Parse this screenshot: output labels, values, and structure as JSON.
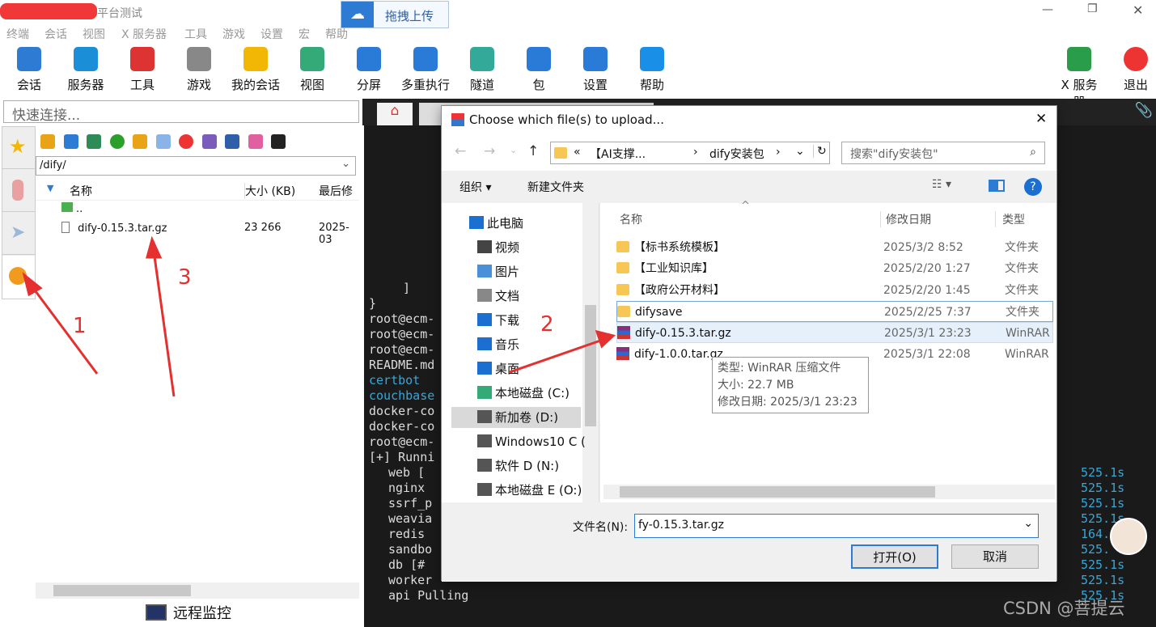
{
  "window": {
    "title": "平台测试",
    "upload_label": "拖拽上传"
  },
  "menu": [
    "终端",
    "会话",
    "视图",
    "X 服务器",
    "工具",
    "游戏",
    "设置",
    "宏",
    "帮助"
  ],
  "toolbar": [
    {
      "label": "会话",
      "icon": "session-icon",
      "color": "#2e7bd4"
    },
    {
      "label": "服务器",
      "icon": "servers-icon",
      "color": "#1a8fd8"
    },
    {
      "label": "工具",
      "icon": "tools-icon",
      "color": "#d33"
    },
    {
      "label": "游戏",
      "icon": "gamepad-icon",
      "color": "#888"
    },
    {
      "label": "我的会话",
      "icon": "star-icon",
      "color": "#f2b705"
    },
    {
      "label": "视图",
      "icon": "view-icon",
      "color": "#3a7"
    },
    {
      "label": "分屏",
      "icon": "split-icon",
      "color": "#2a7bd8"
    },
    {
      "label": "多重执行",
      "icon": "fork-icon",
      "color": "#2a7bd8"
    },
    {
      "label": "隧道",
      "icon": "tunnel-icon",
      "color": "#3a9"
    },
    {
      "label": "包",
      "icon": "package-icon",
      "color": "#2a7bd8"
    },
    {
      "label": "设置",
      "icon": "gear-icon",
      "color": "#2a7bd8"
    },
    {
      "label": "帮助",
      "icon": "help-icon",
      "color": "#1a8fe8"
    }
  ],
  "toolbar_right": [
    {
      "label": "X 服务器",
      "icon": "x-server-icon"
    },
    {
      "label": "退出",
      "icon": "power-icon"
    }
  ],
  "quick_connect": {
    "placeholder": "快速连接..."
  },
  "sftp": {
    "path": "/dify/",
    "headers": [
      "名称",
      "大小 (KB)",
      "最后修"
    ],
    "rows": [
      {
        "name": "..",
        "size": "",
        "date": ""
      },
      {
        "name": "dify-0.15.3.tar.gz",
        "size": "23 266",
        "date": "2025-03"
      }
    ],
    "monitor": "远程监控"
  },
  "terminal": {
    "lines": [
      "]",
      "}",
      "root@ecm-",
      "root@ecm-",
      "root@ecm-",
      "README.md",
      "certbot",
      "couchbase",
      "docker-co",
      "docker-co",
      "root@ecm-",
      "[+] Runni",
      " web [",
      " nginx",
      " ssrf_p",
      " weavia",
      " redis",
      " sandbo",
      " db [#",
      " worker",
      " api Pulling"
    ],
    "times": [
      "525.1s",
      "525.1s",
      "525.1s",
      "525.1s",
      "164.",
      "525.",
      "525.1s",
      "525.1s",
      "525.1s"
    ]
  },
  "dialog": {
    "title": "Choose which file(s) to upload...",
    "address": [
      "«",
      "【AI支撑...",
      "›",
      "dify安装包",
      "›"
    ],
    "search_placeholder": "搜索\"dify安装包\"",
    "organize": "组织 ▾",
    "new_folder": "新建文件夹",
    "nav": [
      "此电脑",
      "视频",
      "图片",
      "文档",
      "下载",
      "音乐",
      "桌面",
      "本地磁盘 (C:)",
      "新加卷 (D:)",
      "Windows10 C (",
      "软件 D (N:)",
      "本地磁盘 E (O:)"
    ],
    "columns": [
      "名称",
      "修改日期",
      "类型"
    ],
    "files": [
      {
        "name": "【标书系统模板】",
        "date": "2025/3/2 8:52",
        "type": "文件夹",
        "kind": "folder"
      },
      {
        "name": "【工业知识库】",
        "date": "2025/2/20 1:27",
        "type": "文件夹",
        "kind": "folder"
      },
      {
        "name": "【政府公开材料】",
        "date": "2025/2/20 1:45",
        "type": "文件夹",
        "kind": "folder"
      },
      {
        "name": "difysave",
        "date": "2025/2/25 7:37",
        "type": "文件夹",
        "kind": "folder"
      },
      {
        "name": "dify-0.15.3.tar.gz",
        "date": "2025/3/1 23:23",
        "type": "WinRAR",
        "kind": "rar"
      },
      {
        "name": "dify-1.0.0.tar.gz",
        "date": "2025/3/1 22:08",
        "type": "WinRAR",
        "kind": "rar"
      }
    ],
    "tooltip": [
      "类型: WinRAR 压缩文件",
      "大小: 22.7 MB",
      "修改日期: 2025/3/1 23:23"
    ],
    "filename_label": "文件名(N):",
    "filename": "fy-0.15.3.tar.gz",
    "open": "打开(O)",
    "cancel": "取消"
  },
  "annotations": [
    "1",
    "2",
    "3"
  ],
  "watermark": "CSDN @菩提云"
}
